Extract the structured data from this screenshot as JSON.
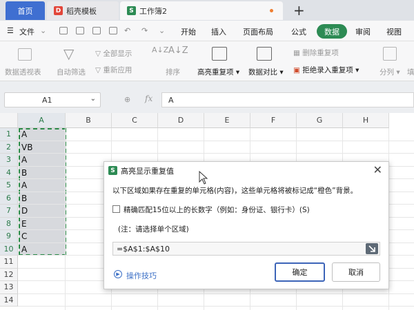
{
  "tabs": [
    {
      "label": "首页"
    },
    {
      "label": "稻壳模板"
    },
    {
      "label": "工作簿2"
    }
  ],
  "menu": {
    "file": "文件",
    "items": [
      "开始",
      "插入",
      "页面布局",
      "公式",
      "数据",
      "审阅",
      "视图"
    ],
    "active": "数据"
  },
  "ribbon": {
    "pivot": "数据透视表",
    "autofilter": "自动筛选",
    "show_all": "全部显示",
    "reapply": "重新应用",
    "sort": "排序",
    "highlight_dup": "高亮重复项",
    "compare": "数据对比",
    "delete_dup": "删除重复项",
    "reject_dup": "拒绝录入重复项",
    "split": "分列",
    "fill": "填"
  },
  "formula_bar": {
    "cell_ref": "A1",
    "fx": "fx",
    "value": "A"
  },
  "grid": {
    "columns": [
      "A",
      "B",
      "C",
      "D",
      "E",
      "F",
      "G",
      "H"
    ],
    "rows": [
      "1",
      "2",
      "3",
      "4",
      "5",
      "6",
      "7",
      "8",
      "9",
      "10",
      "11",
      "12",
      "13",
      "14"
    ],
    "column_a_values": [
      "A",
      "VB",
      "A",
      "B",
      "A",
      "B",
      "D",
      "E",
      "C",
      "A"
    ]
  },
  "dialog": {
    "title": "高亮显示重复值",
    "description": "以下区域如果存在重复的单元格(内容)，这些单元格将被标记成“橙色”背景。",
    "checkbox_label": "精确匹配15位以上的长数字（例如：身份证、银行卡）(S)",
    "checkbox_checked": false,
    "note": "(注：请选择单个区域)",
    "range_value": "=$A$1:$A$10",
    "tips": "操作技巧",
    "ok": "确定",
    "cancel": "取消"
  },
  "colors": {
    "accent_green": "#2d8b54",
    "home_tab_blue": "#3f6fd1",
    "link_blue": "#3b6fc6"
  }
}
